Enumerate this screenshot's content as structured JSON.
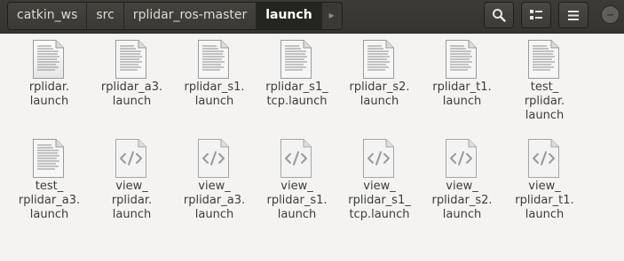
{
  "breadcrumb": [
    {
      "label": "catkin_ws"
    },
    {
      "label": "src"
    },
    {
      "label": "rplidar_ros-master"
    },
    {
      "label": "launch"
    }
  ],
  "breadcrumb_more": "▸",
  "toolbar": {
    "search_icon": "search-icon",
    "view_icon": "list-view-icon",
    "menu_icon": "hamburger-menu-icon"
  },
  "files": [
    {
      "name": "rplidar.\nlaunch",
      "type": "text-document"
    },
    {
      "name": "rplidar_a3.\nlaunch",
      "type": "text-document"
    },
    {
      "name": "rplidar_s1.\nlaunch",
      "type": "text-document"
    },
    {
      "name": "rplidar_s1_\ntcp.launch",
      "type": "text-document"
    },
    {
      "name": "rplidar_s2.\nlaunch",
      "type": "text-document"
    },
    {
      "name": "rplidar_t1.\nlaunch",
      "type": "text-document"
    },
    {
      "name": "test_\nrplidar.\nlaunch",
      "type": "text-document"
    },
    {
      "name": "test_\nrplidar_a3.\nlaunch",
      "type": "text-document"
    },
    {
      "name": "view_\nrplidar.\nlaunch",
      "type": "code-document"
    },
    {
      "name": "view_\nrplidar_a3.\nlaunch",
      "type": "code-document"
    },
    {
      "name": "view_\nrplidar_s1.\nlaunch",
      "type": "code-document"
    },
    {
      "name": "view_\nrplidar_s1_\ntcp.launch",
      "type": "code-document"
    },
    {
      "name": "view_\nrplidar_s2.\nlaunch",
      "type": "code-document"
    },
    {
      "name": "view_\nrplidar_t1.\nlaunch",
      "type": "code-document"
    }
  ]
}
